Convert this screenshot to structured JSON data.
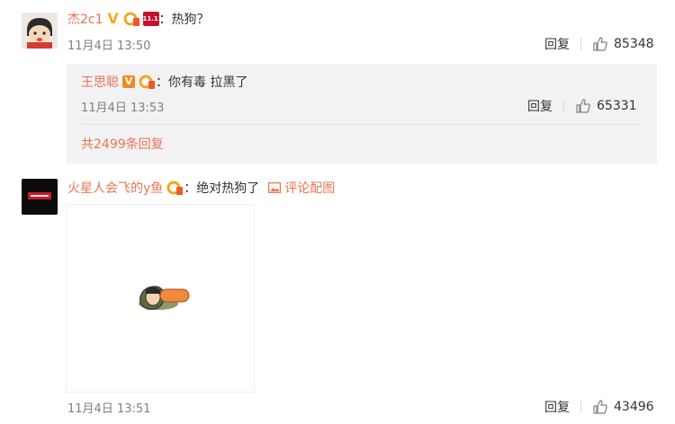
{
  "comments": [
    {
      "username": "杰2c1",
      "text": "：热狗？",
      "time": "11月4日 13:50",
      "reply_label": "回复",
      "likes": "85348",
      "replies": [
        {
          "username": "王思聪",
          "text": "：你有毒 拉黑了",
          "time": "11月4日 13:53",
          "reply_label": "回复",
          "likes": "65331"
        }
      ],
      "more_replies": "共2499条回复"
    },
    {
      "username": "火星人会飞的y鱼",
      "text": "：绝对热狗了",
      "comment_pic_label": "评论配图",
      "time": "11月4日 13:51",
      "reply_label": "回复",
      "likes": "43496"
    }
  ],
  "badges": {
    "event_badge_text": "11.11"
  },
  "colors": {
    "username": "#eb7350",
    "meta": "#808080",
    "reply_bg": "#f2f2f5"
  }
}
